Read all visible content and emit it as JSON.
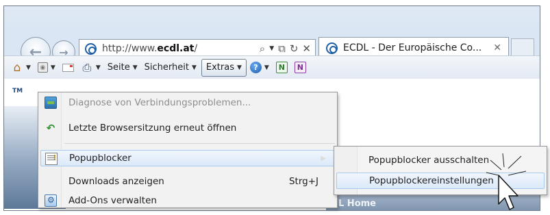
{
  "browser": {
    "address_bar": {
      "url_prefix": "http://www.",
      "url_domain": "ecdl.at",
      "url_suffix": "/",
      "search_icon": "search-icon",
      "compat_icon": "compatibility-view-icon",
      "refresh_icon": "refresh-icon",
      "stop_icon": "stop-icon"
    },
    "tab": {
      "title": "ECDL - Der Europäische Co...",
      "close_glyph": "✕"
    }
  },
  "command_bar": {
    "page_label": "Seite",
    "safety_label": "Sicherheit",
    "tools_label": "Extras",
    "caret": "▼"
  },
  "page": {
    "trademark": "TM",
    "home_bar_text": "L Home"
  },
  "extras_menu": {
    "items": [
      {
        "label": "Diagnose von Verbindungsproblemen...",
        "icon": "network-diagnose-icon",
        "disabled": true
      },
      {
        "label": "Letzte Browsersitzung erneut öffnen",
        "icon": "reopen-session-icon"
      },
      {
        "label": "Popupblocker",
        "icon": "popup-blocker-icon",
        "submenu": true,
        "highlighted": true
      },
      {
        "label": "Downloads anzeigen",
        "shortcut": "Strg+J"
      },
      {
        "label": "Add-Ons verwalten",
        "icon": "manage-addons-icon"
      }
    ]
  },
  "popup_submenu": {
    "items": [
      {
        "label": "Popupblocker ausschalten"
      },
      {
        "label": "Popupblockereinstellungen",
        "highlighted": true
      }
    ]
  },
  "colors": {
    "frame_bg": "#dae6f3",
    "menu_bg": "#f2f2f2",
    "highlight_border": "#a9c8ee",
    "disabled_text": "#8d8d8d"
  }
}
